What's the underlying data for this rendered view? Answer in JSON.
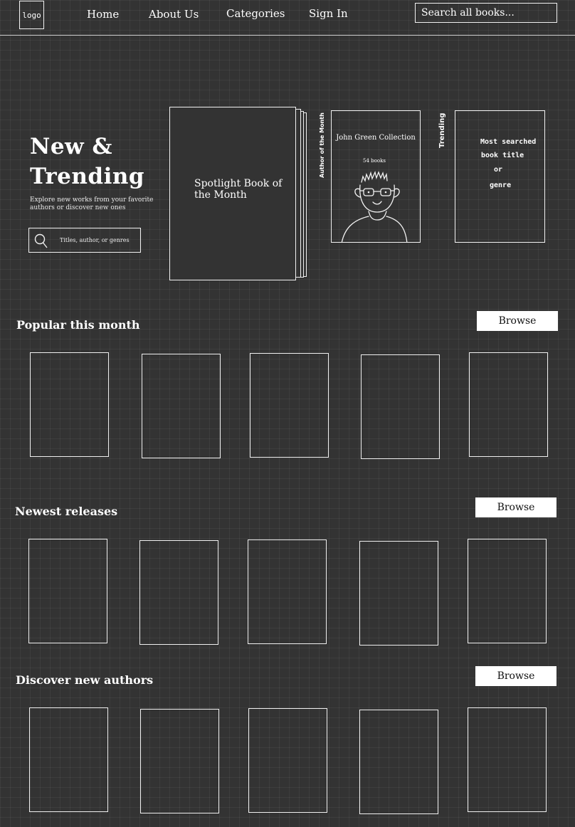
{
  "nav": {
    "logo": "logo",
    "links": [
      "Home",
      "About Us",
      "Categories",
      "Sign In"
    ],
    "search_placeholder": "Search all books..."
  },
  "hero": {
    "title_line1": "New &",
    "title_line2": "Trending",
    "subtitle": "Explore new works from your favorite authors or discover new ones",
    "search_placeholder": "Titles, author, or genres",
    "spotlight_label": "Spotlight Book of the Month",
    "author_label": "Author of the Month",
    "author_name": "John Green Collection",
    "author_count": "54 books",
    "trending_label": "Trending",
    "trending_lines": [
      "Most searched",
      "book title",
      "or",
      "genre"
    ]
  },
  "sections": [
    {
      "title": "Popular this month",
      "browse": "Browse"
    },
    {
      "title": "Newest releases",
      "browse": "Browse"
    },
    {
      "title": "Discover new authors",
      "browse": "Browse"
    }
  ],
  "colors": {
    "background": "#333333",
    "line": "#f2f2f2",
    "button": "#ffffff"
  }
}
